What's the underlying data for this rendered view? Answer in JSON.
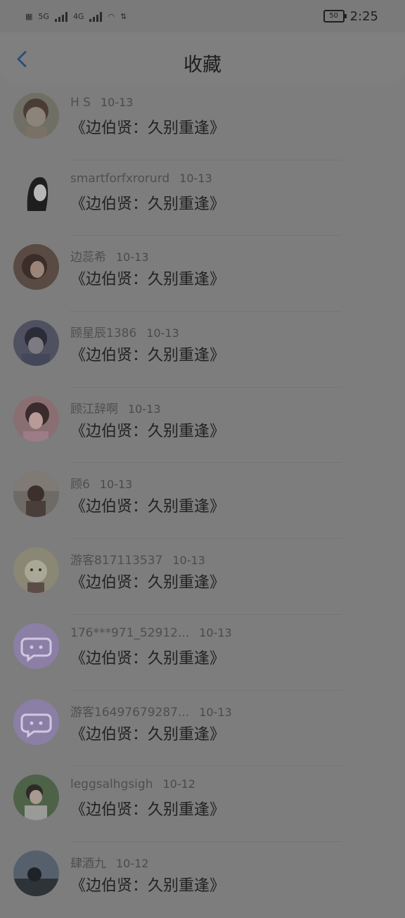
{
  "status": {
    "network_a": "5G",
    "network_b": "4G",
    "battery": "50",
    "time": "2:25"
  },
  "header": {
    "title": "收藏",
    "back_icon": "chevron-left-icon"
  },
  "items": [
    {
      "name": "H S",
      "date": "10-13",
      "content": "《边伯贤：久别重逢》"
    },
    {
      "name": "smartforfxrorurd",
      "date": "10-13",
      "content": "《边伯贤：久别重逢》"
    },
    {
      "name": "边蕊希",
      "date": "10-13",
      "content": "《边伯贤：久别重逢》"
    },
    {
      "name": "顾星辰1386",
      "date": "10-13",
      "content": "《边伯贤：久别重逢》"
    },
    {
      "name": "顾江辞啊",
      "date": "10-13",
      "content": "《边伯贤：久别重逢》"
    },
    {
      "name": "顾6",
      "date": "10-13",
      "content": "《边伯贤：久别重逢》"
    },
    {
      "name": "游客817113537",
      "date": "10-13",
      "content": "《边伯贤：久别重逢》"
    },
    {
      "name": "176***971_52912...",
      "date": "10-13",
      "content": "《边伯贤：久别重逢》"
    },
    {
      "name": "游客16497679287...",
      "date": "10-13",
      "content": "《边伯贤：久别重逢》"
    },
    {
      "name": "leggsalhgsigh",
      "date": "10-12",
      "content": "《边伯贤：久别重逢》"
    },
    {
      "name": "肆酒九",
      "date": "10-12",
      "content": "《边伯贤：久别重逢》"
    }
  ],
  "colors": {
    "overlay_bg": "#7d7d7d",
    "back_arrow": "#2a4f7a",
    "default_avatar": "#8c7fa6"
  }
}
